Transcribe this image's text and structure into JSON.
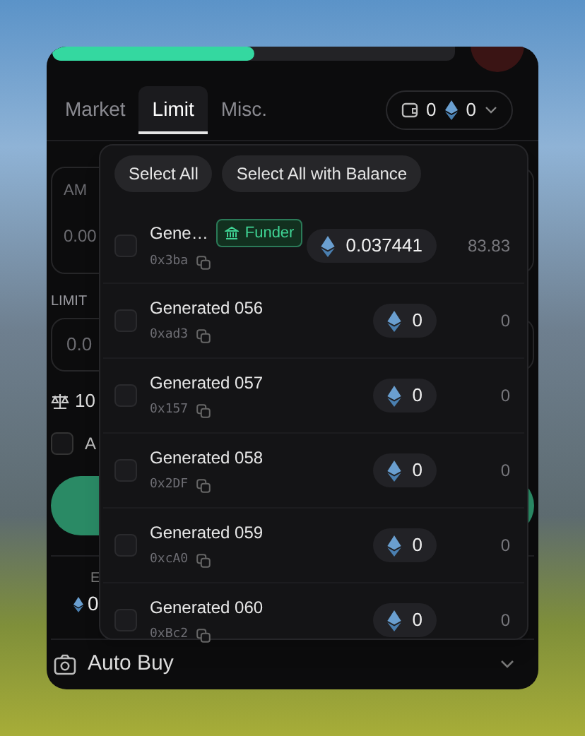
{
  "progress": {
    "level": 0.5
  },
  "tabs": [
    {
      "label": "Market",
      "selected": false
    },
    {
      "label": "Limit",
      "selected": true
    },
    {
      "label": "Misc.",
      "selected": false
    }
  ],
  "wallet_summary": {
    "count": "0",
    "balance": "0"
  },
  "form": {
    "amount_label": "AM",
    "amount_value": "0.00",
    "limit_label": "LIMIT",
    "limit_value": "0.0",
    "ratio": "10",
    "option_label": "A",
    "option_checked": false,
    "estimate_label": "E",
    "estimate_value": "0"
  },
  "wallet_menu": {
    "buttons": [
      "Select All",
      "Select All with Balance"
    ],
    "wallets": [
      {
        "name": "Gene…",
        "badge": "Funder",
        "address": "0x3ba",
        "balance": "0.037441",
        "value": "83.83",
        "checked": false
      },
      {
        "name": "Generated 056",
        "address": "0xad3",
        "balance": "0",
        "value": "0",
        "checked": false
      },
      {
        "name": "Generated 057",
        "address": "0x157",
        "balance": "0",
        "value": "0",
        "checked": false
      },
      {
        "name": "Generated 058",
        "address": "0x2DF",
        "balance": "0",
        "value": "0",
        "checked": false
      },
      {
        "name": "Generated 059",
        "address": "0xcA0",
        "balance": "0",
        "value": "0",
        "checked": false
      },
      {
        "name": "Generated 060",
        "address": "0xBc2",
        "balance": "0",
        "value": "0",
        "checked": false
      }
    ]
  },
  "auto_buy": {
    "label": "Auto Buy"
  }
}
